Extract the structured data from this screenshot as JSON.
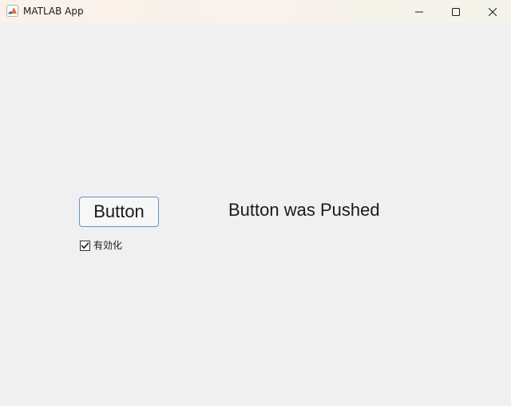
{
  "window": {
    "title": "MATLAB App",
    "app_icon": "matlab-membrane-icon",
    "controls": {
      "minimize_icon": "minimize-icon",
      "maximize_icon": "maximize-icon",
      "close_icon": "close-icon"
    }
  },
  "main": {
    "button_label": "Button",
    "status_text": "Button was Pushed",
    "checkbox": {
      "label": "有効化",
      "checked": true,
      "icon": "checkmark-icon"
    }
  },
  "colors": {
    "background": "#f0f0f0",
    "button_border": "#6a8fc6",
    "text": "#1a1a1a"
  }
}
